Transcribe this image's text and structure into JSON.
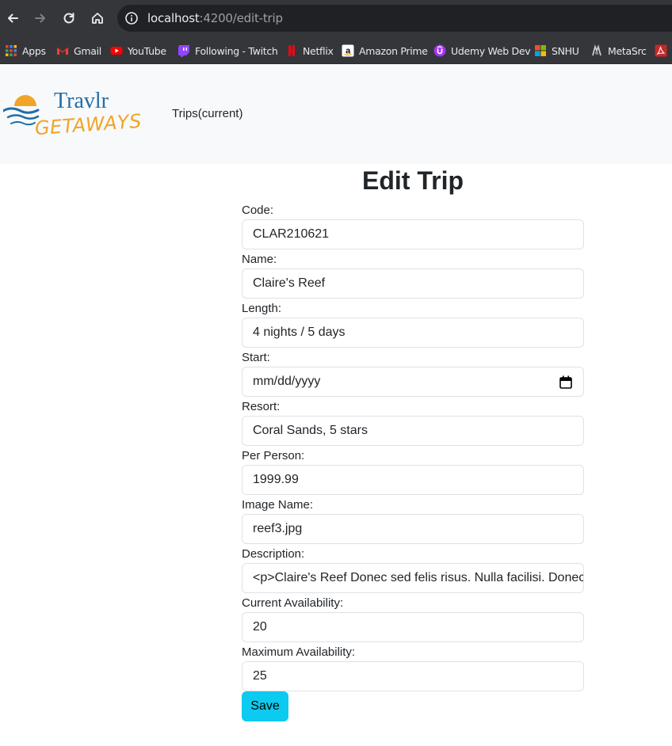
{
  "browser": {
    "url_host": "localhost",
    "url_rest": ":4200/edit-trip",
    "bookmarks": [
      {
        "label": "Apps",
        "icon": "apps-grid-icon"
      },
      {
        "label": "Gmail",
        "icon": "gmail-icon"
      },
      {
        "label": "YouTube",
        "icon": "youtube-icon"
      },
      {
        "label": "Following - Twitch",
        "icon": "twitch-icon"
      },
      {
        "label": "Netflix",
        "icon": "netflix-icon"
      },
      {
        "label": "Amazon Prime",
        "icon": "amazon-icon"
      },
      {
        "label": "Udemy Web Dev",
        "icon": "udemy-icon"
      },
      {
        "label": "SNHU",
        "icon": "microsoft-icon"
      },
      {
        "label": "MetaSrc",
        "icon": "metasrc-icon"
      }
    ]
  },
  "header": {
    "logo_top": "Travlr",
    "logo_bottom": "GETAWAYS",
    "nav_label": "Trips(current)"
  },
  "form": {
    "title": "Edit Trip",
    "fields": [
      {
        "label": "Code:",
        "value": "CLAR210621"
      },
      {
        "label": "Name:",
        "value": "Claire's Reef"
      },
      {
        "label": "Length:",
        "value": "4 nights / 5 days"
      },
      {
        "label": "Start:",
        "value": "mm/dd/yyyy"
      },
      {
        "label": "Resort:",
        "value": "Coral Sands, 5 stars"
      },
      {
        "label": "Per Person:",
        "value": "1999.99"
      },
      {
        "label": "Image Name:",
        "value": "reef3.jpg"
      },
      {
        "label": "Description:",
        "value": "<p>Claire's Reef Donec sed felis risus. Nulla facilisi. Donec"
      },
      {
        "label": "Current Availability:",
        "value": "20"
      },
      {
        "label": "Maximum Availability:",
        "value": "25"
      }
    ],
    "save_label": "Save"
  },
  "colors": {
    "save_button": "#0dcaf0",
    "header_bg": "#f8f9fa",
    "logo_blue": "#1f6ea8",
    "logo_orange": "#f2a428"
  }
}
